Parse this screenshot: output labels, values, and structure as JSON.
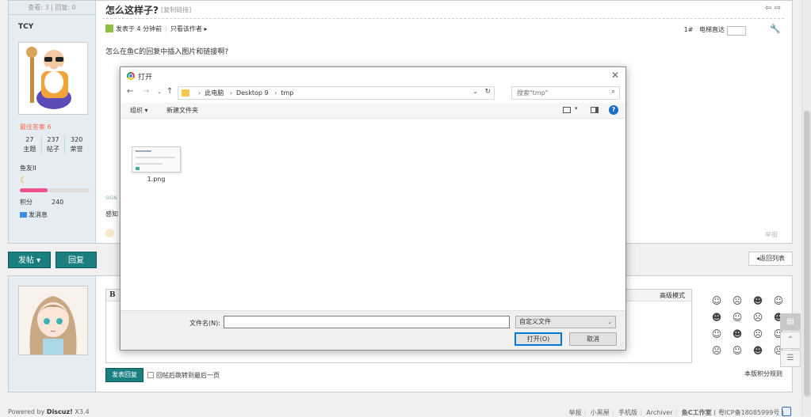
{
  "thread": {
    "views_replies": "查看: 3 | 回复: 0",
    "title": "怎么这样子?",
    "copy_link": "[复制链接]",
    "author": "TCY",
    "rank": "最佳答案 6",
    "counts": [
      {
        "value": "27",
        "label": "主题"
      },
      {
        "value": "237",
        "label": "帖子"
      },
      {
        "value": "320",
        "label": "荣誉"
      }
    ],
    "group": "鱼友II",
    "level_progress": 0.4,
    "score_label": "积分",
    "score_value": "240",
    "pm": "发消息",
    "posted_at": "发表于 4 分钟前",
    "only_author": "只看该作者",
    "floor_num": "1#",
    "floor_jump": "电梯直达",
    "content": "怎么在鱼C的回复中插入图片和链接啊?",
    "sig_partial": "SIGN",
    "partial_text": "感知",
    "report": "举报"
  },
  "actions": {
    "post": "发帖",
    "reply": "回复",
    "return_list": "返回列表"
  },
  "reply_box": {
    "bold": "B",
    "advanced": "高级模式",
    "submit": "发表回复",
    "jump_last": "回帖后跳转到最后一页",
    "rules": "本版积分规则"
  },
  "footer": {
    "powered": "Powered by",
    "brand": "Discuz!",
    "version": "X3.4",
    "links": [
      "举报",
      "小黑屋",
      "手机版",
      "Archiver"
    ],
    "studio": "鱼C工作室",
    "icp": "( 粤ICP备18085999号 )"
  },
  "dialog": {
    "title": "打开",
    "breadcrumb": [
      "此电脑",
      "Desktop 9",
      "tmp"
    ],
    "search_placeholder": "搜索\"tmp\"",
    "organize": "组织",
    "new_folder": "新建文件夹",
    "files": [
      {
        "name": "1.png"
      }
    ],
    "filename_label": "文件名(N):",
    "filename_value": "",
    "filetype": "自定义文件",
    "open_btn": "打开(O)",
    "cancel_btn": "取消"
  }
}
